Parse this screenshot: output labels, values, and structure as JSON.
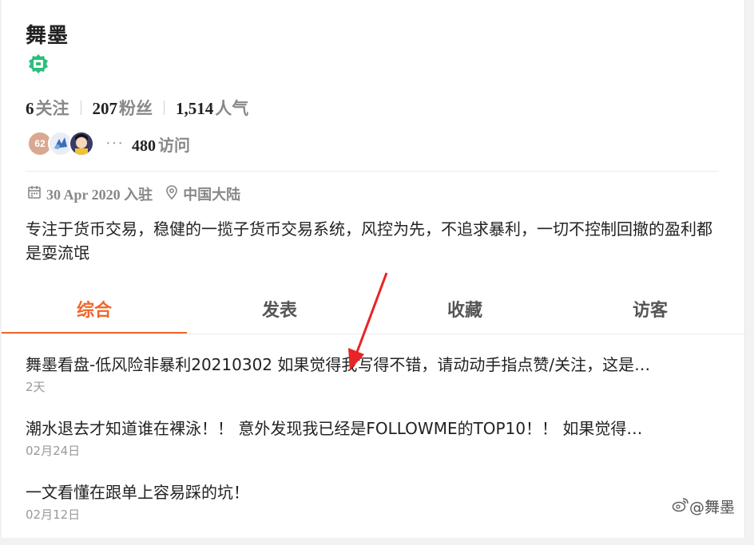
{
  "profile": {
    "username": "舞墨",
    "badge_icon": "wechat-badge-icon",
    "accent_color": "#2bbf7a"
  },
  "stats": {
    "following_count": "6",
    "following_label": "关注",
    "followers_count": "207",
    "followers_label": "粉丝",
    "popularity_count": "1,514",
    "popularity_label": "人气"
  },
  "visitors": {
    "first_avatar_text": "62",
    "more": "···",
    "visit_count": "480",
    "visit_label": "访问"
  },
  "meta": {
    "joined": "30 Apr 2020 入驻",
    "location": "中国大陆"
  },
  "bio": "专注于货币交易，稳健的一揽子货币交易系统，风控为先，不追求暴利，一切不控制回撤的盈利都是耍流氓",
  "tabs": [
    {
      "label": "综合",
      "active": true
    },
    {
      "label": "发表",
      "active": false
    },
    {
      "label": "收藏",
      "active": false
    },
    {
      "label": "访客",
      "active": false
    }
  ],
  "tab_accent": "#f0672a",
  "posts": [
    {
      "title": "舞墨看盘-低风险非暴利20210302 如果觉得我写得不错，请动动手指点赞/关注，这是…",
      "date": "2天"
    },
    {
      "title": "潮水退去才知道谁在裸泳！！ 意外发现我已经是FOLLOWME的TOP10！！ 如果觉得…",
      "date": "02月24日"
    },
    {
      "title": "一文看懂在跟单上容易踩的坑！",
      "date": "02月12日"
    }
  ],
  "watermark": "@舞墨"
}
